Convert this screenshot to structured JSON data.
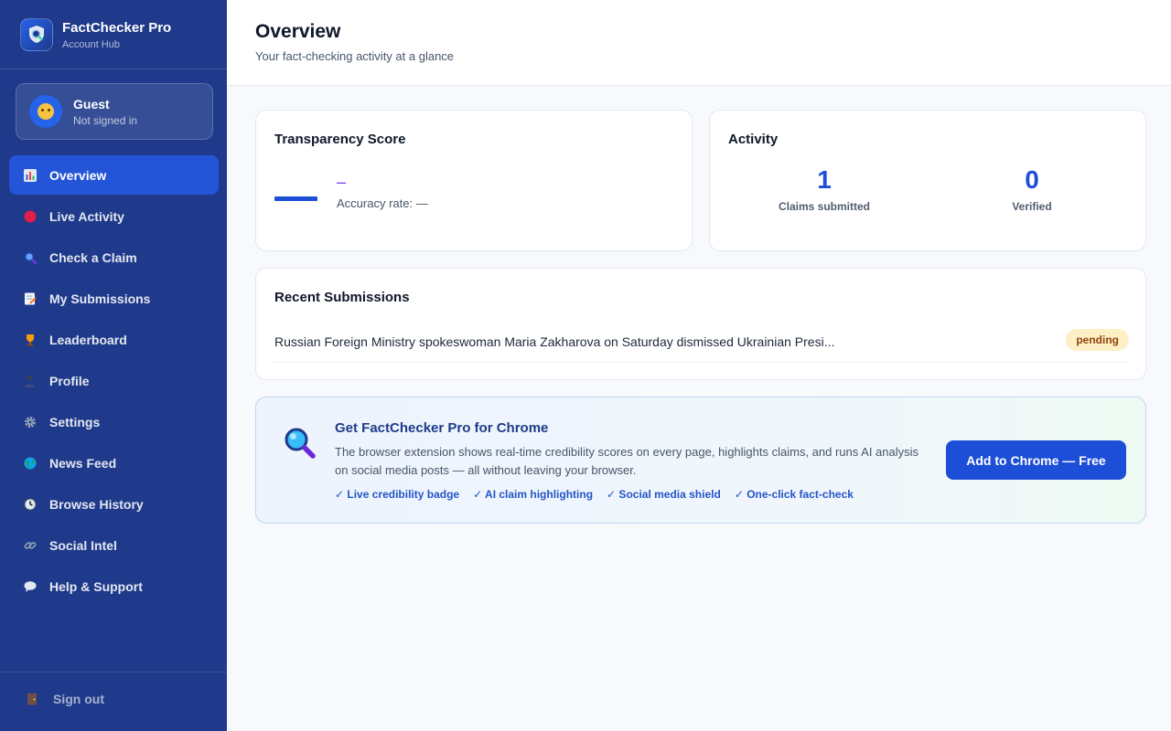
{
  "brand": {
    "title": "FactChecker Pro",
    "subtitle": "Account Hub"
  },
  "user": {
    "name": "Guest",
    "status": "Not signed in"
  },
  "nav": [
    {
      "label": "Overview",
      "icon": "bar-chart-icon",
      "active": true
    },
    {
      "label": "Live Activity",
      "icon": "red-dot-icon"
    },
    {
      "label": "Check a Claim",
      "icon": "magnifier-icon"
    },
    {
      "label": "My Submissions",
      "icon": "memo-icon"
    },
    {
      "label": "Leaderboard",
      "icon": "trophy-icon"
    },
    {
      "label": "Profile",
      "icon": "person-icon"
    },
    {
      "label": "Settings",
      "icon": "gear-icon"
    },
    {
      "label": "News Feed",
      "icon": "globe-icon"
    },
    {
      "label": "Browse History",
      "icon": "clock-icon"
    },
    {
      "label": "Social Intel",
      "icon": "link-icon"
    },
    {
      "label": "Help & Support",
      "icon": "speech-bubble-icon"
    }
  ],
  "signout": {
    "label": "Sign out",
    "icon": "door-icon"
  },
  "header": {
    "title": "Overview",
    "subtitle": "Your fact-checking activity at a glance"
  },
  "transparency": {
    "title": "Transparency Score",
    "value": "–",
    "rate": "Accuracy rate: —"
  },
  "activity": {
    "title": "Activity",
    "stats": [
      {
        "value": "1",
        "label": "Claims submitted"
      },
      {
        "value": "0",
        "label": "Verified"
      }
    ]
  },
  "recent": {
    "title": "Recent Submissions",
    "items": [
      {
        "text": "Russian Foreign Ministry spokeswoman Maria Zakharova on Saturday dismissed Ukrainian Presi...",
        "status": "pending"
      }
    ]
  },
  "promo": {
    "title": "Get FactChecker Pro for Chrome",
    "description": "The browser extension shows real-time credibility scores on every page, highlights claims, and runs AI analysis on social media posts — all without leaving your browser.",
    "features": [
      "✓ Live credibility badge",
      "✓ AI claim highlighting",
      "✓ Social media shield",
      "✓ One-click fact-check"
    ],
    "button": "Add to Chrome — Free"
  },
  "colors": {
    "sidebar": "#1f3a8a",
    "accent": "#1d4ed8",
    "active_nav": "#2454d8",
    "badge_bg": "#fdf0c4",
    "badge_text": "#92400e"
  }
}
